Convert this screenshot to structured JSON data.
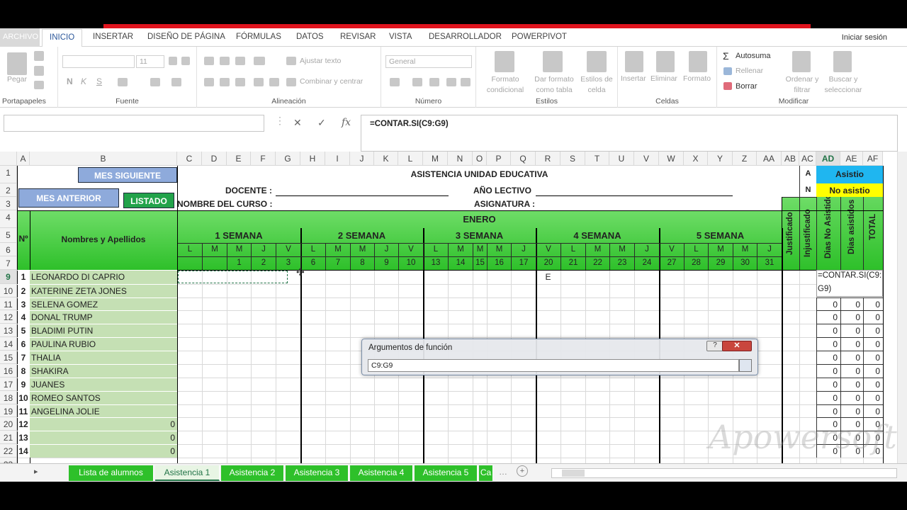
{
  "ribbon_tabs": [
    "ARCHIVO",
    "INICIO",
    "INSERTAR",
    "DISEÑO DE PÁGINA",
    "FÓRMULAS",
    "DATOS",
    "REVISAR",
    "VISTA",
    "DESARROLLADOR",
    "POWERPIVOT"
  ],
  "login": "Iniciar sesión",
  "ribbon": {
    "paste": "Pegar",
    "font_size": "11",
    "bold": "N",
    "italic": "K",
    "underline": "S",
    "wrap": "Ajustar texto",
    "merge": "Combinar y centrar",
    "number_format": "General",
    "cond_format": "Formato condicional",
    "as_table": "Dar formato como tabla",
    "cell_styles": "Estilos de celda",
    "insert": "Insertar",
    "delete": "Eliminar",
    "format": "Formato",
    "autosum": "Autosuma",
    "fill": "Rellenar",
    "clear": "Borrar",
    "sort": "Ordenar y filtrar",
    "find": "Buscar y seleccionar",
    "groups": [
      "Portapapeles",
      "Fuente",
      "Alineación",
      "Número",
      "Estilos",
      "Celdas",
      "Modificar"
    ]
  },
  "formula_bar": {
    "value": "=CONTAR.SI(C9:G9)",
    "fx": "fx"
  },
  "columns": [
    "A",
    "B",
    "C",
    "D",
    "E",
    "F",
    "G",
    "H",
    "I",
    "J",
    "K",
    "L",
    "M",
    "N",
    "O",
    "P",
    "Q",
    "R",
    "S",
    "T",
    "U",
    "V",
    "W",
    "X",
    "Y",
    "Z",
    "AA",
    "AB",
    "AC",
    "AD",
    "AE",
    "AF"
  ],
  "rows": [
    "1",
    "2",
    "3",
    "4",
    "5",
    "6",
    "7",
    "9",
    "10",
    "11",
    "12",
    "13",
    "14",
    "15",
    "16",
    "17",
    "18",
    "19",
    "20",
    "21",
    "22",
    "23"
  ],
  "sheet": {
    "btn_next": "MES SIGUIENTE",
    "btn_prev": "MES ANTERIOR",
    "btn_list": "LISTADO",
    "title": "ASISTENCIA UNIDAD EDUCATIVA",
    "docente": "DOCENTE :",
    "curso": "NOMBRE DEL CURSO :",
    "anio": "AÑO LECTIVO",
    "asignatura": "ASIGNATURA :",
    "legend_a": "A",
    "legend_a_text": "Asistio",
    "legend_n": "N",
    "legend_n_text": "No asistio",
    "num_header": "Nº",
    "names_header": "Nombres y Apellidos",
    "month": "ENERO",
    "weeks": [
      "1 SEMANA",
      "2 SEMANA",
      "3 SEMANA",
      "4 SEMANA",
      "5 SEMANA"
    ],
    "days": [
      "L",
      "M",
      "M",
      "J",
      "V",
      "L",
      "M",
      "M",
      "J",
      "V",
      "L",
      "M",
      "M",
      "M",
      "J",
      "V",
      "L",
      "M",
      "M",
      "J",
      "V",
      "L",
      "M",
      "M",
      "J",
      "V"
    ],
    "dates": [
      "",
      "",
      "1",
      "2",
      "3",
      "6",
      "7",
      "8",
      "9",
      "10",
      "13",
      "14",
      "15",
      "16",
      "17",
      "20",
      "21",
      "22",
      "23",
      "24",
      "27",
      "28",
      "29",
      "30",
      "31"
    ],
    "vert_headers": [
      "Justificado",
      "Injustificado",
      "Dias No Asistido",
      "Dias asistidos",
      "TOTAL"
    ],
    "mark_e": "E",
    "formula_cell": "=CONTAR.SI(C9:",
    "formula_cell2": "G9)",
    "students": [
      {
        "n": "1",
        "name": "LEONARDO DI CAPRIO"
      },
      {
        "n": "2",
        "name": "KATERINE ZETA JONES"
      },
      {
        "n": "3",
        "name": "SELENA GOMEZ"
      },
      {
        "n": "4",
        "name": "DONAL TRUMP"
      },
      {
        "n": "5",
        "name": "BLADIMI PUTIN"
      },
      {
        "n": "6",
        "name": "PAULINA RUBIO"
      },
      {
        "n": "7",
        "name": "THALIA"
      },
      {
        "n": "8",
        "name": "SHAKIRA"
      },
      {
        "n": "9",
        "name": "JUANES"
      },
      {
        "n": "10",
        "name": "ROMEO SANTOS"
      },
      {
        "n": "11",
        "name": "ANGELINA JOLIE"
      },
      {
        "n": "12",
        "name": "0"
      },
      {
        "n": "13",
        "name": "0"
      },
      {
        "n": "14",
        "name": "0"
      }
    ],
    "zero": "0"
  },
  "dialog": {
    "title": "Argumentos de función",
    "help": "?",
    "close": "✕",
    "input": "C9:G9"
  },
  "sheet_tabs": [
    "Lista de alumnos",
    "Asistencia 1",
    "Asistencia 2",
    "Asistencia 3",
    "Asistencia 4",
    "Asistencia 5",
    "Ca"
  ],
  "watermark": "Apowersoft"
}
